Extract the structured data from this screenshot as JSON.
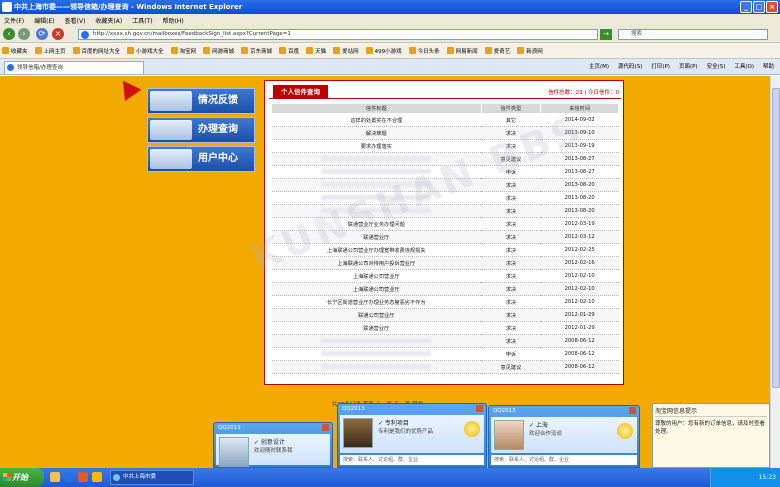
{
  "window": {
    "title": "中共上海市委——领导信箱/办理查询 - Windows Internet Explorer"
  },
  "menu": [
    "文件(F)",
    "编辑(E)",
    "查看(V)",
    "收藏夹(A)",
    "工具(T)",
    "帮助(H)"
  ],
  "address": {
    "url": "http://xxxx.sh.gov.cn/mailboxes/FeedbackSign_list.aspx?CurrentPage=1",
    "search_placeholder": "搜索"
  },
  "favorites": [
    {
      "label": "收藏夹"
    },
    {
      "label": "上网主页"
    },
    {
      "label": "百度的网址大全"
    },
    {
      "label": "小游戏大全"
    },
    {
      "label": "淘宝网"
    },
    {
      "label": "网游商城"
    },
    {
      "label": "京东商城"
    },
    {
      "label": "百度"
    },
    {
      "label": "天猫"
    },
    {
      "label": "爱站网"
    },
    {
      "label": "499小游戏"
    },
    {
      "label": "今日头条"
    },
    {
      "label": "网易新闻"
    },
    {
      "label": "爱奇艺"
    },
    {
      "label": "新浪网"
    }
  ],
  "tab": {
    "label": "领导信箱/办理查询"
  },
  "commands": [
    "主页(M)",
    "源代码(S)",
    "打印(P)",
    "页面(P)",
    "安全(S)",
    "工具(O)",
    "帮助"
  ],
  "sidebar": [
    {
      "label": "情况反馈"
    },
    {
      "label": "办理查询"
    },
    {
      "label": "用户中心"
    }
  ],
  "panel": {
    "title": "个人信件查询",
    "stats": "信件总数：23 | 今日信件：0",
    "columns": [
      "信件标题",
      "信件类型",
      "来信时间"
    ],
    "rows": [
      {
        "title": "这样的处置实在不合理",
        "type": "其它",
        "date": "2014-09-02"
      },
      {
        "title": "解决难题",
        "type": "求决",
        "date": "2013-09-10"
      },
      {
        "title": "要求办理落实",
        "type": "求决",
        "date": "2013-09-19"
      },
      {
        "title": "",
        "type": "意见建议",
        "date": "2013-08-27"
      },
      {
        "title": "",
        "type": "申诉",
        "date": "2013-08-27"
      },
      {
        "title": "",
        "type": "求决",
        "date": "2013-08-20"
      },
      {
        "title": "",
        "type": "求决",
        "date": "2013-08-20"
      },
      {
        "title": "",
        "type": "求决",
        "date": "2013-08-20"
      },
      {
        "title": "联通营业厅业务办理问题",
        "type": "求决",
        "date": "2012-03-19"
      },
      {
        "title": "联通营业厅",
        "type": "求决",
        "date": "2012-03-12"
      },
      {
        "title": "上海联通公司营业厅办理宽带收费违规损失",
        "type": "求决",
        "date": "2012-02-25"
      },
      {
        "title": "上海联通公司对待用户投诉营业厅",
        "type": "求决",
        "date": "2012-02-16"
      },
      {
        "title": "上海联通公司营业厅",
        "type": "求决",
        "date": "2012-02-10"
      },
      {
        "title": "上海联通公司营业厅",
        "type": "求决",
        "date": "2012-02-10"
      },
      {
        "title": "长宁区街道营业厅办理业务态度恶劣不作为",
        "type": "求决",
        "date": "2012-02-10"
      },
      {
        "title": "联通公司营业厅",
        "type": "求决",
        "date": "2012-01-29"
      },
      {
        "title": "联通营业厅",
        "type": "求决",
        "date": "2012-01-29"
      },
      {
        "title": "",
        "type": "求决",
        "date": "2008-06-12"
      },
      {
        "title": "",
        "type": "申诉",
        "date": "2008-06-12"
      },
      {
        "title": "",
        "type": "意见建议",
        "date": "2008-06-12"
      }
    ],
    "pager": "共23条记录 首页 上一页 下一页 尾页"
  },
  "watermark": "KUNSHAN BBS",
  "qq_popups": [
    {
      "title": "QQ2013",
      "name": "✓ 创意设计",
      "sign": "欢迎随时联系我"
    },
    {
      "title": "QQ2013",
      "name": "✓ 专利项目",
      "sign": "专利是我们的优势产品",
      "search": "搜索：联系人、讨论组、群、企业"
    },
    {
      "title": "QQ2013",
      "name": "✓ 上海",
      "sign": "欢迎合作洽谈",
      "search": "搜索：联系人、讨论组、群、企业"
    }
  ],
  "notice": {
    "title": "淘宝网信息提示",
    "body": "尊敬的用户：您有新的订单信息，请及时查看处理。"
  },
  "taskbar": {
    "start": "开始",
    "active_window": "中共上海市委",
    "clock": "15:23"
  }
}
